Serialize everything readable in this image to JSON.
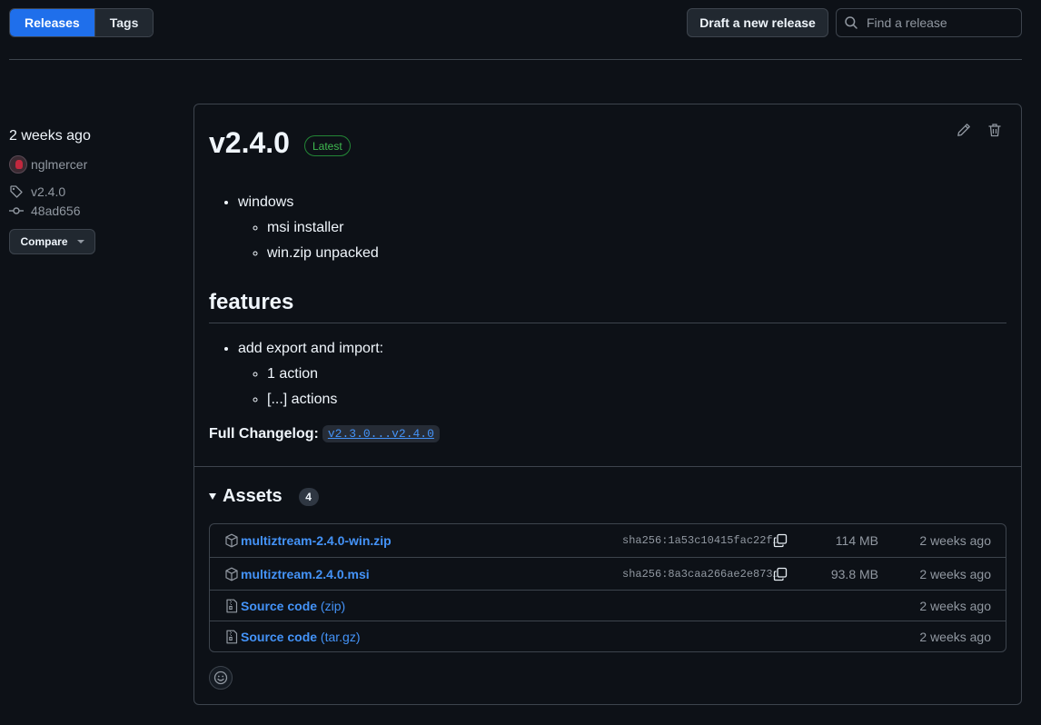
{
  "nav": {
    "tabs": [
      {
        "label": "Releases",
        "active": true
      },
      {
        "label": "Tags",
        "active": false
      }
    ],
    "draft_label": "Draft a new release",
    "search_placeholder": "Find a release"
  },
  "meta": {
    "date": "2 weeks ago",
    "author": "nglmercer",
    "tag": "v2.4.0",
    "commit": "48ad656",
    "compare_label": "Compare"
  },
  "release": {
    "title": "v2.4.0",
    "badge": "Latest",
    "platform_item": "windows",
    "platform_subitems": [
      "msi installer",
      "win.zip unpacked"
    ],
    "features_heading": "features",
    "feature_item": "add export and import:",
    "feature_subitems": [
      "1 action",
      "[...] actions"
    ],
    "changelog_label": "Full Changelog:",
    "changelog_link": "v2.3.0...v2.4.0"
  },
  "assets": {
    "heading": "Assets",
    "count": "4",
    "items": [
      {
        "name": "multiztream-2.4.0-win.zip",
        "sha": "sha256:1a53c10415fac22f…",
        "size": "114 MB",
        "date": "2 weeks ago"
      },
      {
        "name": "multiztream.2.4.0.msi",
        "sha": "sha256:8a3caa266ae2e873…",
        "size": "93.8 MB",
        "date": "2 weeks ago"
      },
      {
        "name": "Source code",
        "suffix": "(zip)",
        "date": "2 weeks ago"
      },
      {
        "name": "Source code",
        "suffix": "(tar.gz)",
        "date": "2 weeks ago"
      }
    ]
  },
  "colors": {
    "accent": "#1f6feb",
    "link": "#4493f8",
    "latest_green": "#3fb950",
    "background": "#0d1117"
  }
}
